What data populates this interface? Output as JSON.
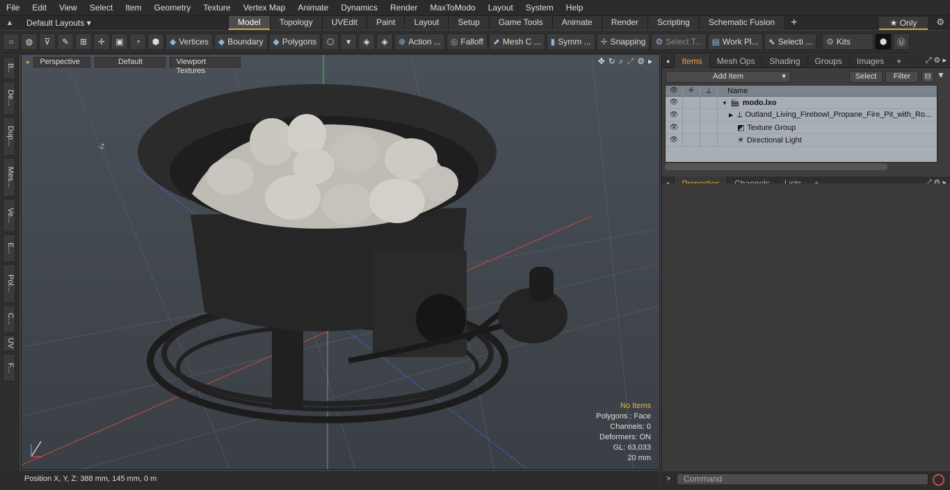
{
  "menu": [
    "File",
    "Edit",
    "View",
    "Select",
    "Item",
    "Geometry",
    "Texture",
    "Vertex Map",
    "Animate",
    "Dynamics",
    "Render",
    "MaxToModo",
    "Layout",
    "System",
    "Help"
  ],
  "layout": {
    "selector": "Default Layouts ▾",
    "tabs": [
      "Model",
      "Topology",
      "UVEdit",
      "Paint",
      "Layout",
      "Setup",
      "Game Tools",
      "Animate",
      "Render",
      "Scripting",
      "Schematic Fusion"
    ],
    "active_tab": "Model",
    "only_label": "★ Only"
  },
  "toolbar": {
    "vertices": "Vertices",
    "boundary": "Boundary",
    "polygons": "Polygons",
    "action": "Action ...",
    "falloff": "Falloff",
    "mesh": "Mesh C ...",
    "symm": "Symm ...",
    "snapping": "Snapping",
    "select_t": "Select T...",
    "workpl": "Work Pl...",
    "selecti": "Selecti ...",
    "kits": "Kits"
  },
  "left_strip": [
    "B..",
    "De...",
    "Dup...",
    "Mes...",
    "Ve...",
    "E...",
    "Pol...",
    "C...",
    "UV",
    "F..."
  ],
  "viewport": {
    "view": "Perspective",
    "shading": "Default",
    "textures": "Viewport Textures",
    "axis_label": "-Z",
    "info": {
      "no_items": "No Items",
      "polygons": "Polygons : Face",
      "channels": "Channels: 0",
      "deformers": "Deformers: ON",
      "gl": "GL: 63,033",
      "grid": "20 mm"
    }
  },
  "status": {
    "position": "Position X, Y, Z:   388 mm, 145 mm, 0 m"
  },
  "panel": {
    "tabs": [
      "Items",
      "Mesh Ops",
      "Shading",
      "Groups",
      "Images"
    ],
    "active": "Items",
    "add_item": "Add Item",
    "select": "Select",
    "filter": "Filter",
    "col_name": "Name",
    "tree": [
      {
        "name": "modo.lxo",
        "indent": 0,
        "expander": "▼",
        "icon": "🎬"
      },
      {
        "name": "Outland_Living_Firebowl_Propane_Fire_Pit_with_Ro...",
        "indent": 1,
        "expander": "▶",
        "icon": "⟂"
      },
      {
        "name": "Texture Group",
        "indent": 1,
        "expander": "",
        "icon": "◩"
      },
      {
        "name": "Directional Light",
        "indent": 1,
        "expander": "",
        "icon": "☀"
      }
    ]
  },
  "props_tabs": {
    "tabs": [
      "Properties",
      "Channels",
      "Lists"
    ],
    "active": "Properties"
  },
  "command": {
    "placeholder": "Command"
  },
  "colors": {
    "accent": "#e1a33a",
    "props_tab_active": "#f0a838",
    "info_highlight": "#e8b83a",
    "tree_bg": "#a7aeb5"
  }
}
